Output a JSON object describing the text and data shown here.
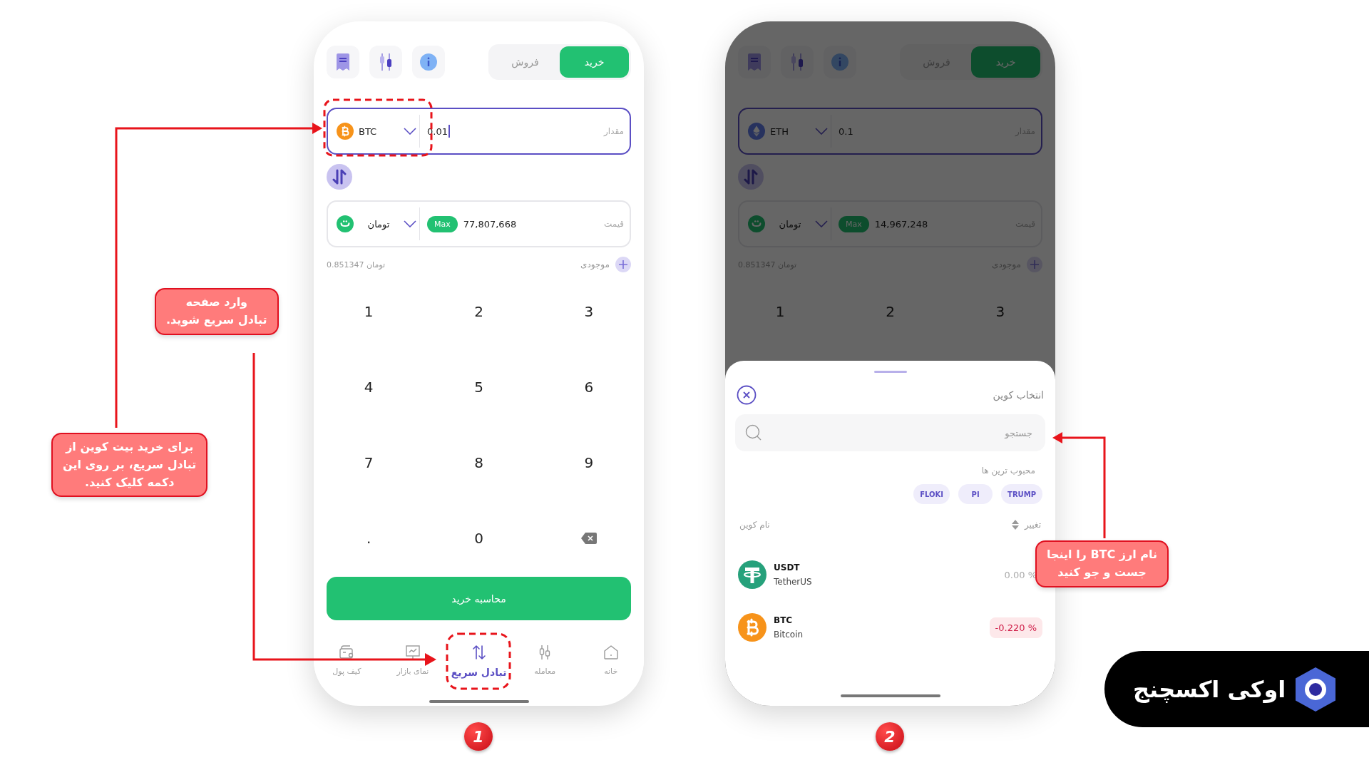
{
  "phones": [
    {
      "step": "2",
      "dimmed": true,
      "tabs": [
        {
          "label": "خرید",
          "selected": true
        },
        {
          "label": "فروش",
          "selected": false
        }
      ],
      "amount": {
        "label": "مقدار",
        "coin": "ETH",
        "value": "0.1",
        "focused": true,
        "caret": false
      },
      "price": {
        "label": "قیمت",
        "coin": "تومان",
        "max": "Max",
        "value": "14,967,248",
        "focused": false
      },
      "balance": {
        "label": "موجودی",
        "value": "0.851347 تومان"
      },
      "keypad": [
        {
          "kind": "digit",
          "label": "3"
        },
        {
          "kind": "digit",
          "label": "2"
        },
        {
          "kind": "digit",
          "label": "1"
        }
      ],
      "sheet": {
        "title": "انتخاب کوین",
        "search": {
          "placeholder": "جستجو"
        },
        "popular_label": "محبوب ترین ها",
        "chips": [
          "TRUMP",
          "PI",
          "FLOKI"
        ],
        "columns": {
          "change": "تغییر",
          "name": "نام کوین"
        },
        "coins": [
          {
            "symbol": "USDT",
            "name": "TetherUS",
            "change": "0.00 %",
            "kind": "flat"
          },
          {
            "symbol": "BTC",
            "name": "Bitcoin",
            "change": "-0.220 %",
            "kind": "down"
          }
        ]
      }
    },
    {
      "step": "1",
      "dimmed": false,
      "tabs": [
        {
          "label": "خرید",
          "selected": true
        },
        {
          "label": "فروش",
          "selected": false
        }
      ],
      "amount": {
        "label": "مقدار",
        "coin": "BTC",
        "value": "0.01",
        "focused": true,
        "caret": true
      },
      "price": {
        "label": "قیمت",
        "coin": "تومان",
        "max": "Max",
        "value": "77,807,668",
        "focused": false
      },
      "balance": {
        "label": "موجودی",
        "value": "0.851347 تومان"
      },
      "keypad": [
        {
          "kind": "digit",
          "label": "3"
        },
        {
          "kind": "digit",
          "label": "2"
        },
        {
          "kind": "digit",
          "label": "1"
        },
        {
          "kind": "digit",
          "label": "6"
        },
        {
          "kind": "digit",
          "label": "5"
        },
        {
          "kind": "digit",
          "label": "4"
        },
        {
          "kind": "digit",
          "label": "9"
        },
        {
          "kind": "digit",
          "label": "8"
        },
        {
          "kind": "digit",
          "label": "7"
        },
        {
          "kind": "backspace"
        },
        {
          "kind": "digit",
          "label": "0"
        },
        {
          "kind": "digit",
          "label": "."
        }
      ],
      "submit": "محاسبه خرید",
      "nav": [
        {
          "label": "خانه",
          "selected": false
        },
        {
          "label": "معامله",
          "selected": false
        },
        {
          "label": "تبادل سریع",
          "selected": true
        },
        {
          "label": "نمای بازار",
          "selected": false
        },
        {
          "label": "کیف پول",
          "selected": false
        }
      ]
    }
  ],
  "callouts": [
    {
      "text": "وارد صفحه\nتبادل سریع شوید."
    },
    {
      "text": "برای خرید بیت کوین از\nتبادل سریع، بر روی این\nدکمه کلیک کنید."
    },
    {
      "text": "نام ارز BTC را اینجا\nجست و جو کنید"
    }
  ],
  "brand": {
    "name": "اوکی اکسچنج"
  }
}
